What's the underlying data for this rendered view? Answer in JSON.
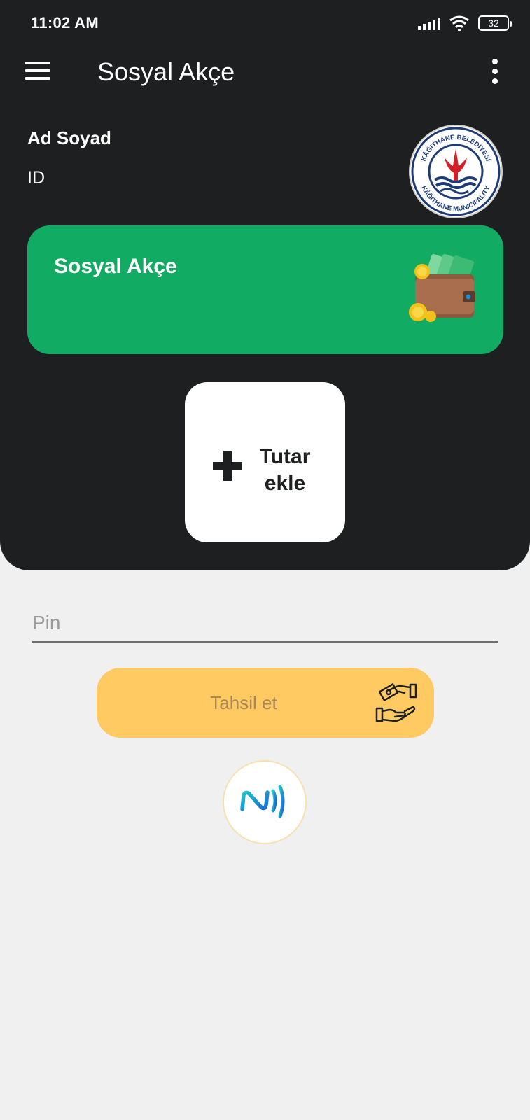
{
  "status_bar": {
    "time": "11:02 AM",
    "battery": "32"
  },
  "app_bar": {
    "title": "Sosyal Akçe",
    "menu_icon": "hamburger-menu-icon",
    "more_icon": "more-vertical-icon"
  },
  "user": {
    "name_label": "Ad Soyad",
    "id_label": "ID"
  },
  "logo": {
    "top_text": "KÂĞITHANE BELEDİYESİ",
    "bottom_text": "KÂĞITHANE MUNICIPALITY"
  },
  "balance_card": {
    "title": "Sosyal Akçe",
    "icon": "wallet-icon",
    "color": "#12ab64"
  },
  "add_amount": {
    "label_line1": "Tutar",
    "label_line2": "ekle",
    "icon": "plus-icon"
  },
  "pin": {
    "placeholder": "Pin",
    "value": ""
  },
  "collect_button": {
    "label": "Tahsil et",
    "icon": "hand-money-icon",
    "color": "#ffca62"
  },
  "nfc": {
    "icon": "nfc-icon"
  },
  "colors": {
    "dark_background": "#1e1f21",
    "page_background": "#f0f0f0",
    "accent_green": "#12ab64",
    "accent_yellow": "#ffca62"
  }
}
